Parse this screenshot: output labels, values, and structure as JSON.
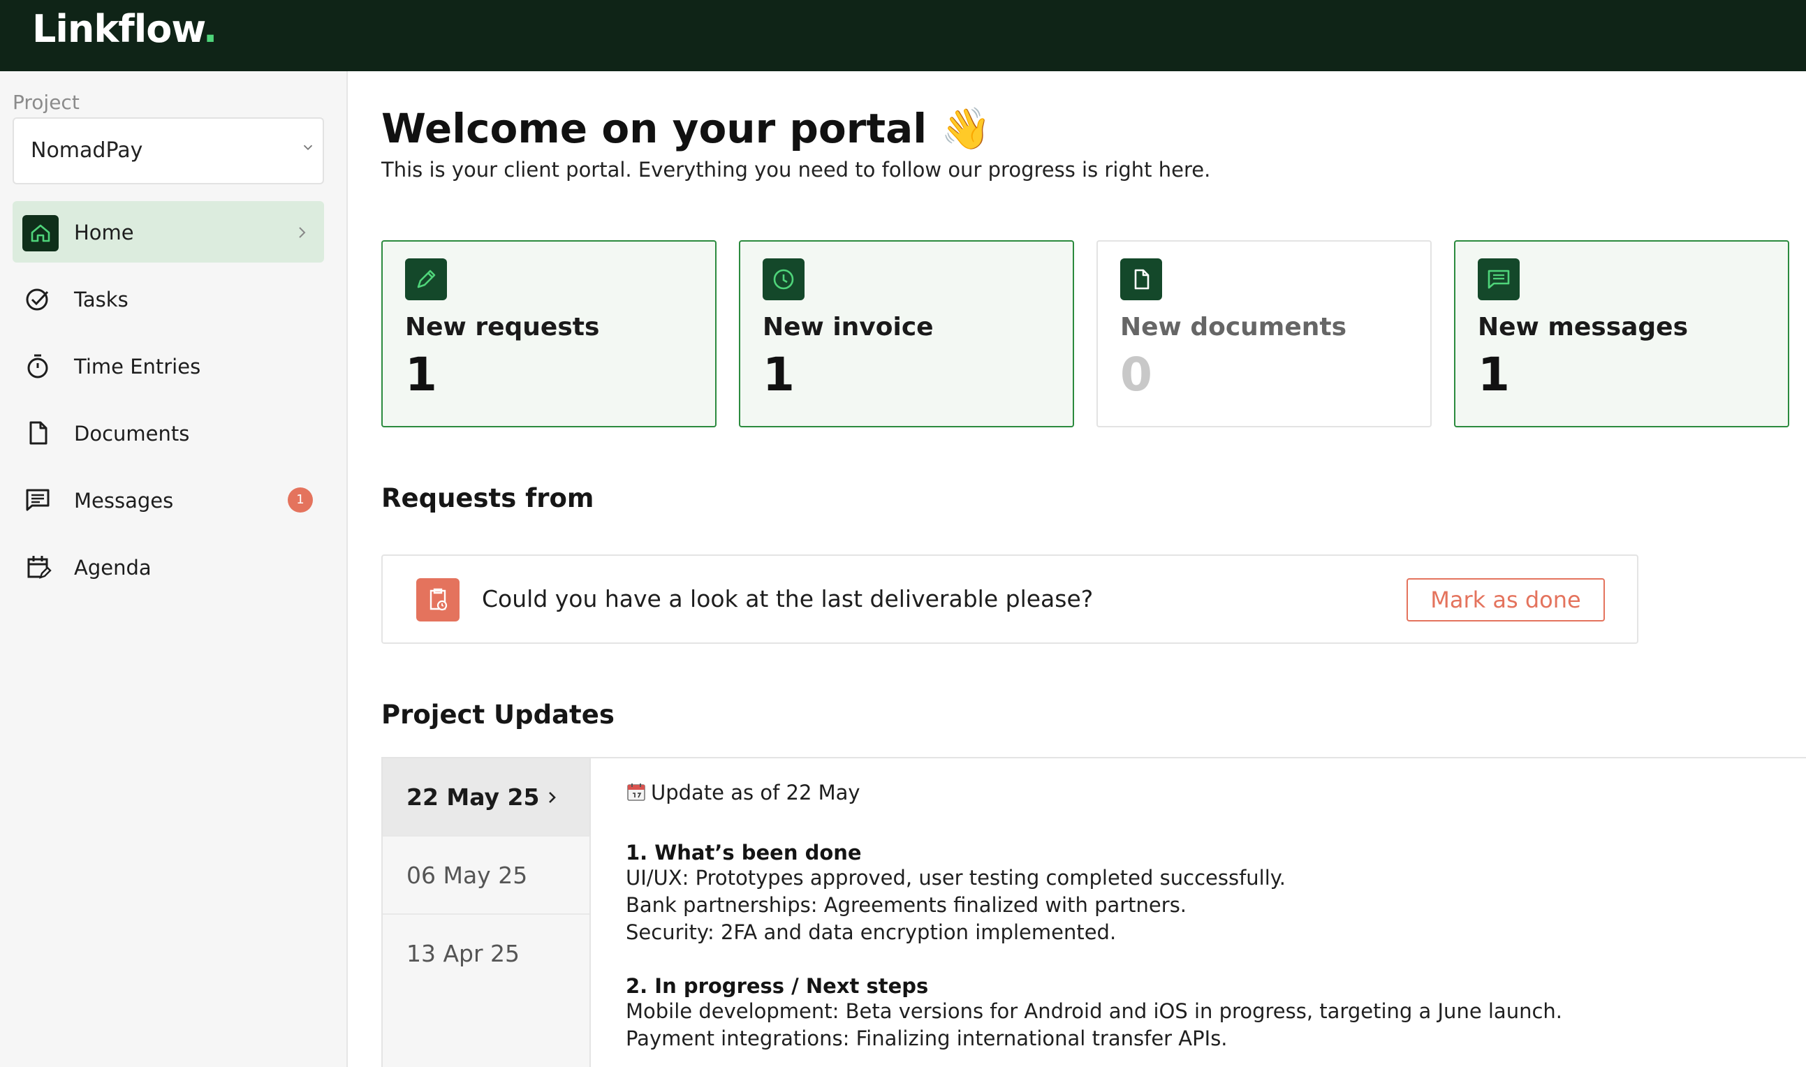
{
  "brand": {
    "name": "Linkflow",
    "dot": "."
  },
  "colors": {
    "topbar": "#0f2417",
    "accent": "#2b8a3e",
    "accent_dark": "#14482a",
    "danger": "#e4735d",
    "active_nav": "#dcecde"
  },
  "sidebar": {
    "project_label": "Project",
    "project_value": "NomadPay",
    "items": [
      {
        "label": "Home",
        "icon": "home-icon",
        "active": true
      },
      {
        "label": "Tasks",
        "icon": "check-circle-icon"
      },
      {
        "label": "Time Entries",
        "icon": "stopwatch-icon"
      },
      {
        "label": "Documents",
        "icon": "document-icon"
      },
      {
        "label": "Messages",
        "icon": "message-icon",
        "badge": "1"
      },
      {
        "label": "Agenda",
        "icon": "calendar-edit-icon"
      }
    ]
  },
  "main": {
    "title": "Welcome on your portal",
    "title_emoji": "👋",
    "subtitle": "This is your client portal. Everything you need to follow our progress is right here.",
    "cards": [
      {
        "title": "New requests",
        "value": "1",
        "icon": "pencil-icon"
      },
      {
        "title": "New invoice",
        "value": "1",
        "icon": "clock-icon"
      },
      {
        "title": "New documents",
        "value": "0",
        "icon": "document-icon"
      },
      {
        "title": "New messages",
        "value": "1",
        "icon": "message-icon"
      }
    ],
    "requests_title": "Requests from",
    "request": {
      "text": "Could you have a look at the last deliverable please?",
      "button": "Mark as done",
      "icon": "clipboard-clock-icon"
    },
    "updates_title": "Project Updates",
    "dates": [
      "22 May 25",
      "06 May 25",
      "13 Apr 25"
    ],
    "update": {
      "heading": "Update as of 22 May",
      "sections": [
        {
          "title": "1. What’s been done",
          "lines": [
            "UI/UX: Prototypes approved, user testing completed successfully.",
            "Bank partnerships: Agreements finalized with partners.",
            "Security: 2FA and data encryption implemented."
          ]
        },
        {
          "title": "2. In progress / Next steps",
          "lines": [
            "Mobile development: Beta versions for Android and iOS in progress, targeting a June launch.",
            "Payment integrations: Finalizing international transfer APIs."
          ]
        }
      ]
    }
  }
}
